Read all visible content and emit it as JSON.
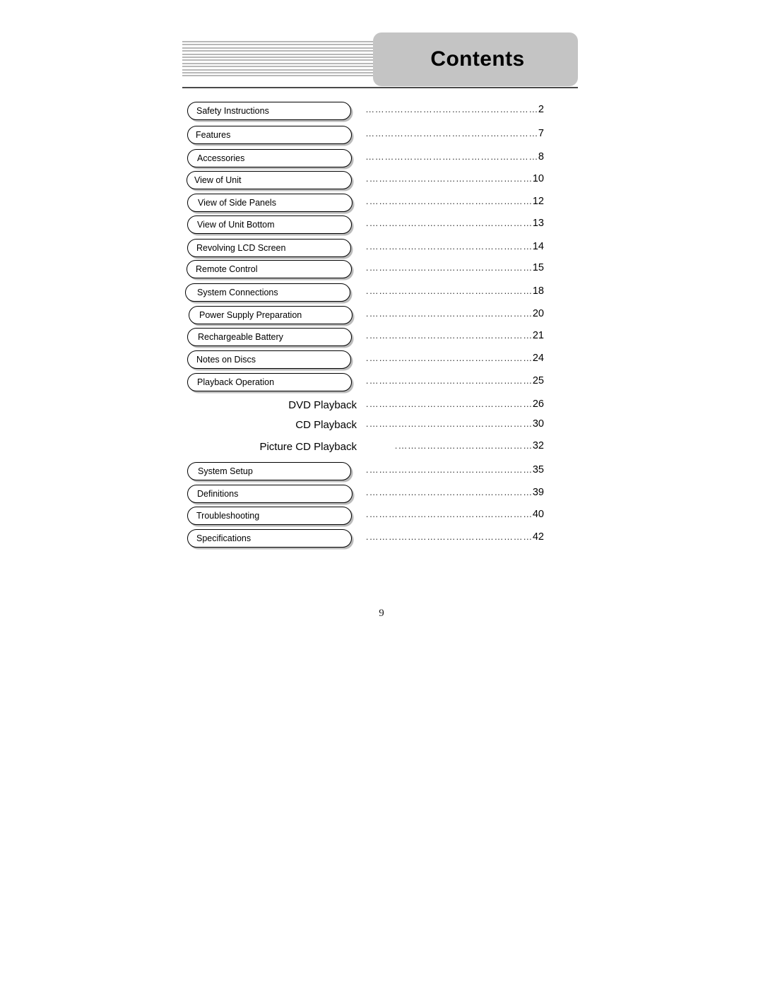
{
  "header": {
    "title": "Contents",
    "stripe_count": 12
  },
  "colors": {
    "band_background": "#c4c4c4",
    "rule": "#4a4a4a",
    "stripe": "#b8b8b8",
    "text": "#000000"
  },
  "toc": {
    "leader_text": "……………………………………………………………………………",
    "entries": [
      {
        "label": "Safety Instructions",
        "page": "2",
        "style": "boxed"
      },
      {
        "label": "Features",
        "page": "7",
        "style": "boxed"
      },
      {
        "label": "Accessories",
        "page": "8",
        "style": "boxed"
      },
      {
        "label": "View of Unit",
        "page": "10",
        "style": "boxed"
      },
      {
        "label": "View of Side Panels",
        "page": "12",
        "style": "boxed"
      },
      {
        "label": "View of Unit Bottom",
        "page": "13",
        "style": "boxed"
      },
      {
        "label": "Revolving LCD Screen",
        "page": "14",
        "style": "boxed"
      },
      {
        "label": "Remote Control",
        "page": "15",
        "style": "boxed"
      },
      {
        "label": "System Connections",
        "page": "18",
        "style": "boxed"
      },
      {
        "label": "Power Supply Preparation",
        "page": "20",
        "style": "boxed"
      },
      {
        "label": "Rechargeable Battery",
        "page": "21",
        "style": "boxed"
      },
      {
        "label": "Notes on Discs",
        "page": "24",
        "style": "boxed"
      },
      {
        "label": "Playback Operation",
        "page": "25",
        "style": "boxed"
      },
      {
        "label": "DVD Playback",
        "page": "26",
        "style": "sub"
      },
      {
        "label": "CD Playback",
        "page": "30",
        "style": "sub"
      },
      {
        "label": "Picture CD Playback",
        "page": "32",
        "style": "sub"
      },
      {
        "label": "System Setup",
        "page": "35",
        "style": "boxed"
      },
      {
        "label": "Definitions",
        "page": "39",
        "style": "boxed"
      },
      {
        "label": "Troubleshooting",
        "page": "40",
        "style": "boxed"
      },
      {
        "label": "Specifications",
        "page": "42",
        "style": "boxed"
      }
    ]
  },
  "folio": {
    "page_number": "9"
  }
}
